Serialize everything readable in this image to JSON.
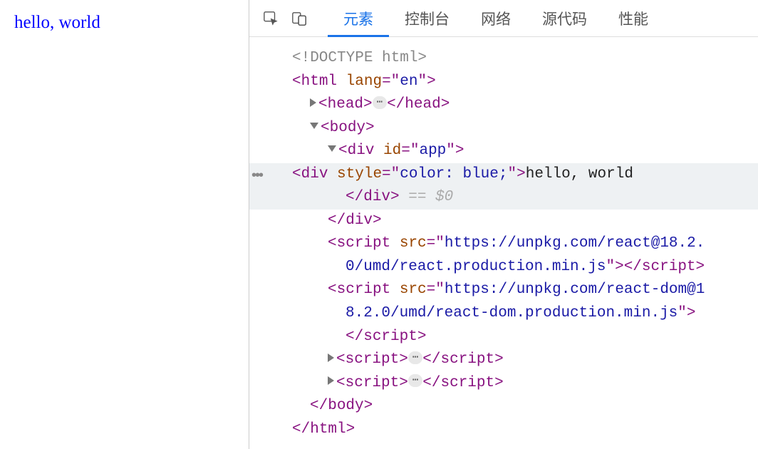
{
  "page": {
    "hello_text": "hello, world"
  },
  "devtools": {
    "tabs": {
      "elements": "元素",
      "console": "控制台",
      "network": "网络",
      "sources": "源代码",
      "performance": "性能"
    },
    "badge_ellipsis": "⋯",
    "dom": {
      "doctype": "<!DOCTYPE html>",
      "html_open_lang": "en",
      "selected_style": "color: blue;",
      "selected_text": "hello, world",
      "selected_suffix": " == $0",
      "app_id": "app",
      "script1_src": "https://unpkg.com/react@18.2.0/umd/react.production.min.js",
      "script2_src": "https://unpkg.com/react-dom@18.2.0/umd/react-dom.production.min.js"
    }
  }
}
